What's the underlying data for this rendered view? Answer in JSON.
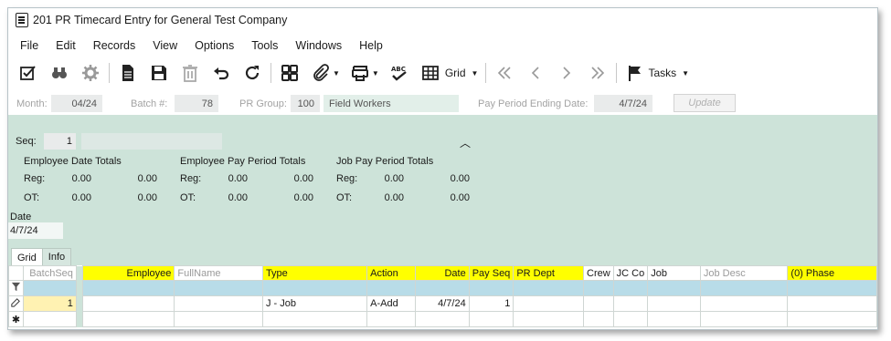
{
  "window": {
    "title": "201 PR Timecard Entry for General Test Company"
  },
  "menu": [
    "File",
    "Edit",
    "Records",
    "View",
    "Options",
    "Tools",
    "Windows",
    "Help"
  ],
  "toolbar": {
    "grid_label": "Grid",
    "tasks_label": "Tasks"
  },
  "header": {
    "month_label": "Month:",
    "month_value": "04/24",
    "batch_label": "Batch #:",
    "batch_value": "78",
    "pr_group_label": "PR Group:",
    "pr_group_value": "100",
    "pr_group_desc": "Field Workers",
    "pay_period_label": "Pay Period Ending Date:",
    "pay_period_value": "4/7/24",
    "update_label": "Update"
  },
  "detail": {
    "seq_label": "Seq:",
    "seq_value": "1",
    "date_label": "Date",
    "date_value": "4/7/24"
  },
  "totals": [
    {
      "title": "Employee Date Totals",
      "reg_label": "Reg:",
      "ot_label": "OT:",
      "reg": [
        "0.00",
        "0.00"
      ],
      "ot": [
        "0.00",
        "0.00"
      ]
    },
    {
      "title": "Employee Pay Period Totals",
      "reg_label": "Reg:",
      "ot_label": "OT:",
      "reg": [
        "0.00",
        "0.00"
      ],
      "ot": [
        "0.00",
        "0.00"
      ]
    },
    {
      "title": "Job Pay Period Totals",
      "reg_label": "Reg:",
      "ot_label": "OT:",
      "reg": [
        "0.00",
        "0.00"
      ],
      "ot": [
        "0.00",
        "0.00"
      ]
    }
  ],
  "tabs": [
    "Grid",
    "Info"
  ],
  "left_grid": {
    "header": "BatchSeq",
    "row": "1"
  },
  "grid": {
    "columns": [
      "Employee",
      "FullName",
      "Type",
      "Action",
      "Date",
      "Pay Seq",
      "PR Dept",
      "Crew",
      "JC Co",
      "Job",
      "Job Desc",
      "(0) Phase"
    ],
    "row": [
      "",
      "",
      "J - Job",
      "A-Add",
      "4/7/24",
      "1",
      "",
      "",
      "",
      "",
      "",
      ""
    ]
  },
  "colors": {
    "panel_green": "#cde3d9",
    "required_yellow": "#ffff00",
    "filter_blue": "#b8dce8"
  }
}
